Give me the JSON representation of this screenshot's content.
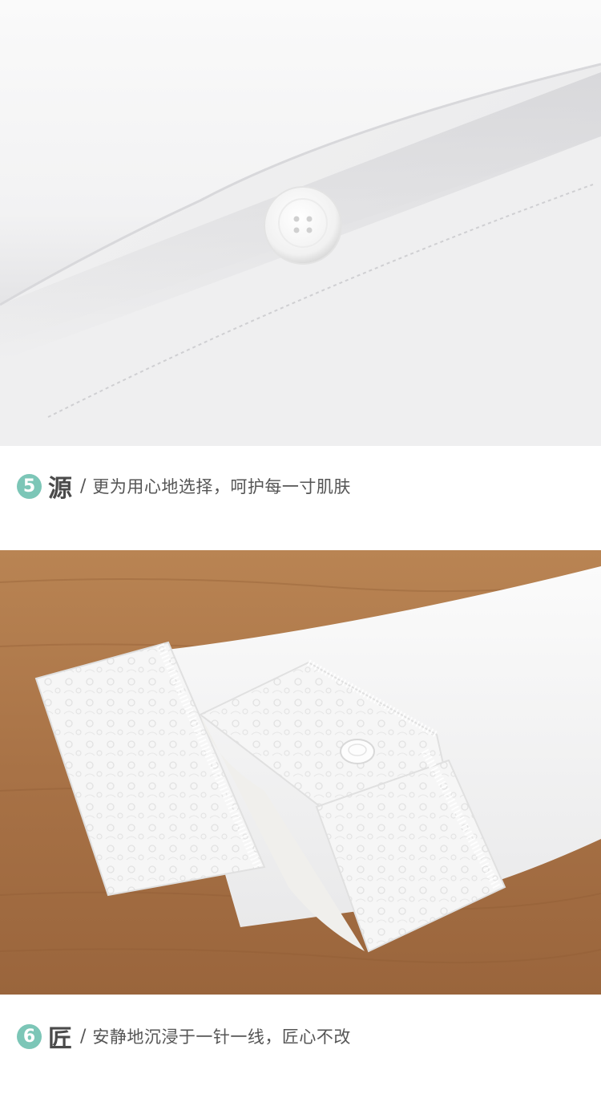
{
  "sections": [
    {
      "number": "5",
      "title_char": "源",
      "separator": "/",
      "description": "更为用心地选择，呵护每一寸肌肤"
    },
    {
      "number": "6",
      "title_char": "匠",
      "separator": "/",
      "description": "安静地沉浸于一针一线，匠心不改"
    }
  ],
  "colors": {
    "accent_circle": "#7cc6b7",
    "title_text": "#4a4a4a",
    "body_text": "#555555",
    "wood": "#b07a4c",
    "fabric": "#f7f7f6"
  },
  "images": {
    "top_photo": "white-shirt-placket-button-closeup",
    "bottom_photo": "embroidered-cuff-sleeves-on-wood"
  }
}
